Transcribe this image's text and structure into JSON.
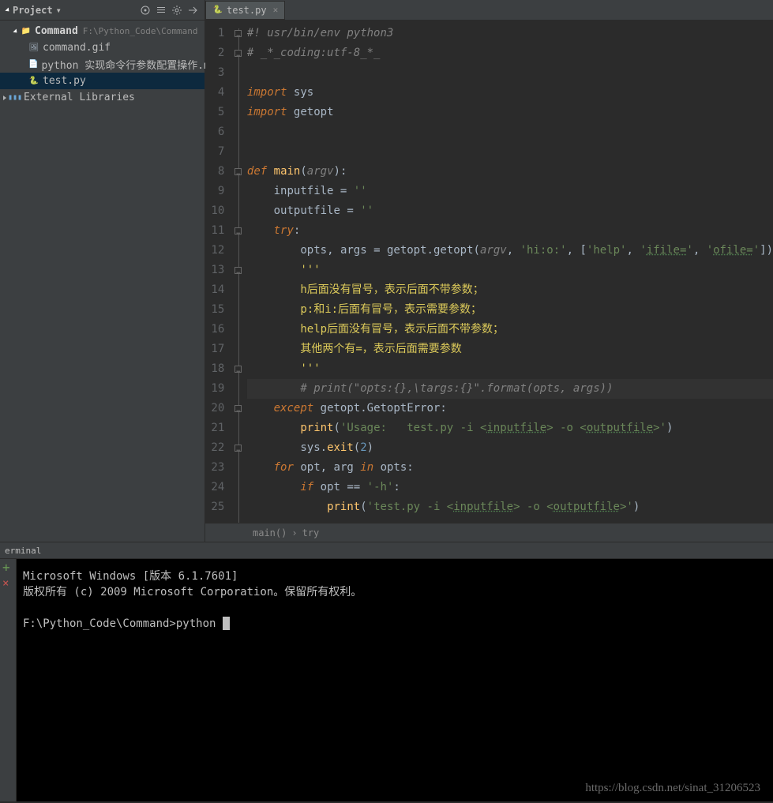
{
  "sidebar": {
    "title": "Project",
    "project": {
      "name": "Command",
      "path": "F:\\Python_Code\\Command"
    },
    "files": [
      {
        "name": "command.gif",
        "icon": "gif"
      },
      {
        "name": "python 实现命令行参数配置操作.md",
        "icon": "md"
      },
      {
        "name": "test.py",
        "icon": "py",
        "selected": true
      }
    ],
    "ext": "External Libraries"
  },
  "tab": {
    "label": "test.py"
  },
  "code": {
    "lines": [
      {
        "n": 1,
        "t": "comment",
        "txt": "#! usr/bin/env python3"
      },
      {
        "n": 2,
        "t": "comment",
        "txt": "# _*_coding:utf-8_*_"
      },
      {
        "n": 3,
        "t": "blank"
      },
      {
        "n": 4,
        "t": "import",
        "mod": "sys"
      },
      {
        "n": 5,
        "t": "import",
        "mod": "getopt"
      },
      {
        "n": 6,
        "t": "blank"
      },
      {
        "n": 7,
        "t": "blank"
      },
      {
        "n": 8,
        "t": "def",
        "name": "main",
        "arg": "argv"
      },
      {
        "n": 9,
        "t": "assign",
        "ind": 1,
        "var": "inputfile",
        "val": "''"
      },
      {
        "n": 10,
        "t": "assign",
        "ind": 1,
        "var": "outputfile",
        "val": "''"
      },
      {
        "n": 11,
        "t": "try",
        "ind": 1
      },
      {
        "n": 12,
        "t": "getopt",
        "ind": 2
      },
      {
        "n": 13,
        "t": "doc",
        "ind": 2,
        "txt": "'''"
      },
      {
        "n": 14,
        "t": "doc",
        "ind": 2,
        "txt": "h后面没有冒号，表示后面不带参数；"
      },
      {
        "n": 15,
        "t": "doc",
        "ind": 2,
        "txt": "p:和i:后面有冒号，表示需要参数；"
      },
      {
        "n": 16,
        "t": "doc",
        "ind": 2,
        "txt": "help后面没有冒号，表示后面不带参数；"
      },
      {
        "n": 17,
        "t": "doc",
        "ind": 2,
        "txt": "其他两个有=，表示后面需要参数"
      },
      {
        "n": 18,
        "t": "doc",
        "ind": 2,
        "txt": "'''"
      },
      {
        "n": 19,
        "t": "pcomment",
        "ind": 2,
        "txt": "# print(\"opts:{},\\targs:{}\".format(opts, args))"
      },
      {
        "n": 20,
        "t": "except",
        "ind": 1
      },
      {
        "n": 21,
        "t": "print",
        "ind": 2,
        "txt": "'Usage:   test.py -i <inputfile> -o <outputfile>'"
      },
      {
        "n": 22,
        "t": "exit",
        "ind": 2
      },
      {
        "n": 23,
        "t": "for",
        "ind": 1
      },
      {
        "n": 24,
        "t": "if",
        "ind": 2
      },
      {
        "n": 25,
        "t": "print2",
        "ind": 3,
        "txt": "'test.py -i <inputfile> -o <outputfile>'"
      }
    ]
  },
  "breadcrumb": [
    "main()",
    "try"
  ],
  "terminal": {
    "label": "erminal",
    "lines": [
      "Microsoft Windows [版本 6.1.7601]",
      "版权所有 (c) 2009 Microsoft Corporation。保留所有权利。",
      "",
      "F:\\Python_Code\\Command>python "
    ]
  },
  "watermark": "https://blog.csdn.net/sinat_31206523"
}
